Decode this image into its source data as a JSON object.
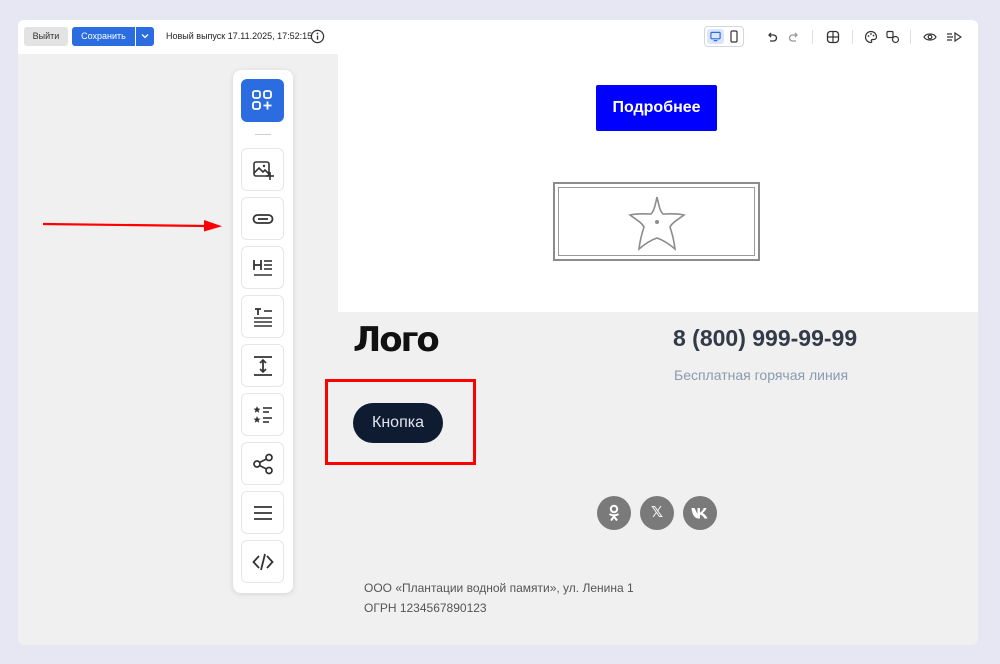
{
  "toolbar": {
    "exit_label": "Выйти",
    "save_label": "Сохранить",
    "release_text": "Новый выпуск 17.11.2025, 17:52:15",
    "icons": [
      "info-icon",
      "desktop-icon",
      "mobile-icon",
      "undo-icon",
      "redo-icon",
      "grid-icon",
      "palette-icon",
      "translate-icon",
      "preview-icon",
      "send-icon"
    ]
  },
  "sidebar": {
    "items": [
      "blocks-icon",
      "image-icon",
      "button-icon",
      "heading-icon",
      "text-icon",
      "spacer-icon",
      "list-icon",
      "share-icon",
      "menu-icon",
      "code-icon"
    ]
  },
  "email": {
    "more_button": "Подробнее",
    "logo": "Лого",
    "phone": "8 (800) 999-99-99",
    "hotline": "Бесплатная горячая линия",
    "button": "Кнопка",
    "social": {
      "ok": "ok-icon",
      "x": "𝕏",
      "vk": "vk-icon"
    },
    "footer_address": "ООО «Плантации водной памяти», ул. Ленина 1",
    "footer_ogrn": "ОГРН 1234567890123"
  },
  "colors": {
    "accent": "#2b6de0",
    "more_button": "#0000ff",
    "dark_button": "#0f1b30",
    "highlight": "#ff0000"
  }
}
